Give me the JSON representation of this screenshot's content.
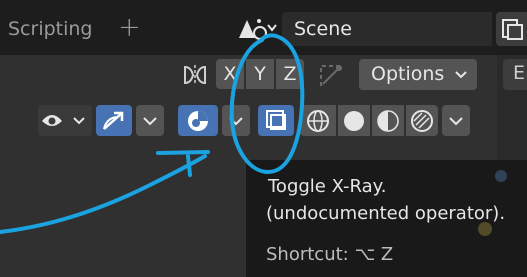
{
  "topbar": {
    "workspace_tab": "Scripting",
    "add_tab": "+",
    "scene_name": "Scene"
  },
  "header": {
    "axis_x": "X",
    "axis_y": "Y",
    "axis_z": "Z",
    "options_label": "Options",
    "right_editor_label": "E"
  },
  "tooltip": {
    "title": "Toggle X-Ray.",
    "description": "(undocumented operator).",
    "shortcut": "Shortcut: ⌥ Z"
  },
  "icons": {
    "mirror": "butterfly-mirror-icon",
    "auto_normalize": "auto-normalize-icon",
    "visibility": "eye-icon",
    "gizmo": "gizmo-arrow-icon",
    "overlays": "overlays-icon",
    "xray": "xray-icon",
    "shading_wireframe": "wireframe-sphere-icon",
    "shading_solid": "solid-sphere-icon",
    "shading_material": "material-sphere-icon",
    "shading_rendered": "rendered-sphere-icon"
  },
  "colors": {
    "active_blue": "#4772b3",
    "annotation_cyan": "#1aa3e0",
    "tooltip_bg": "#191919"
  }
}
